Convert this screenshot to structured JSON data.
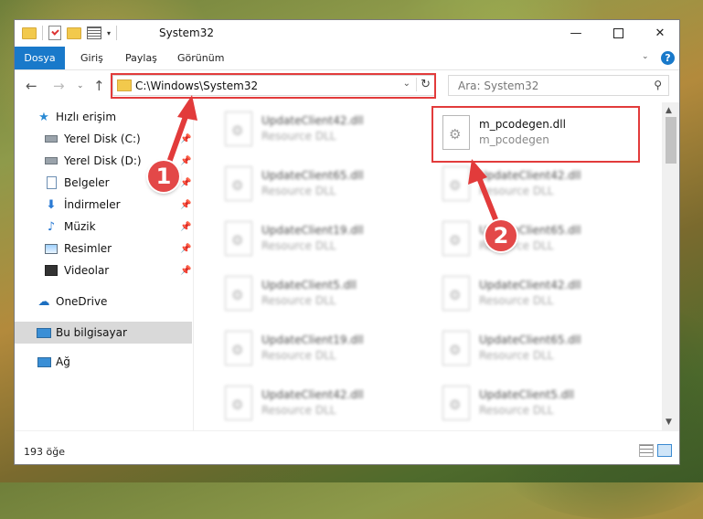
{
  "window": {
    "title": "System32",
    "minimize": "—",
    "close": "✕"
  },
  "ribbon": {
    "tabs": [
      "Dosya",
      "Giriş",
      "Paylaş",
      "Görünüm"
    ],
    "help": "?"
  },
  "nav": {
    "back": "←",
    "forward": "→",
    "recent": "⌄",
    "up": "↑",
    "address": "C:\\Windows\\System32",
    "search_placeholder": "Ara: System32"
  },
  "sidebar": {
    "items": [
      {
        "label": "Hızlı erişim",
        "icon": "star-icon"
      },
      {
        "label": "Yerel Disk (C:)",
        "icon": "disk-icon"
      },
      {
        "label": "Yerel Disk (D:)",
        "icon": "disk-icon"
      },
      {
        "label": "Belgeler",
        "icon": "documents-icon"
      },
      {
        "label": "İndirmeler",
        "icon": "download-icon"
      },
      {
        "label": "Müzik",
        "icon": "music-icon"
      },
      {
        "label": "Resimler",
        "icon": "pictures-icon"
      },
      {
        "label": "Videolar",
        "icon": "videos-icon"
      },
      {
        "label": "OneDrive",
        "icon": "cloud-icon"
      },
      {
        "label": "Bu bilgisayar",
        "icon": "computer-icon"
      },
      {
        "label": "Ağ",
        "icon": "network-icon"
      }
    ]
  },
  "files": {
    "left": [
      {
        "name": "UpdateClient42.dll",
        "desc": "Resource DLL"
      },
      {
        "name": "UpdateClient65.dll",
        "desc": "Resource DLL"
      },
      {
        "name": "UpdateClient19.dll",
        "desc": "Resource DLL"
      },
      {
        "name": "UpdateClient5.dll",
        "desc": "Resource DLL"
      },
      {
        "name": "UpdateClient19.dll",
        "desc": "Resource DLL"
      },
      {
        "name": "UpdateClient42.dll",
        "desc": "Resource DLL"
      }
    ],
    "right": [
      {
        "name": "m_pcodegen.dll",
        "desc": "m_pcodegen"
      },
      {
        "name": "UpdateClient42.dll",
        "desc": "Resource DLL"
      },
      {
        "name": "UpdateClient65.dll",
        "desc": "Resource DLL"
      },
      {
        "name": "UpdateClient42.dll",
        "desc": "Resource DLL"
      },
      {
        "name": "UpdateClient65.dll",
        "desc": "Resource DLL"
      },
      {
        "name": "UpdateClient5.dll",
        "desc": "Resource DLL"
      }
    ]
  },
  "status": {
    "count": "193 öğe"
  },
  "annotations": {
    "step1": "1",
    "step2": "2",
    "color": "#e23b3b"
  }
}
